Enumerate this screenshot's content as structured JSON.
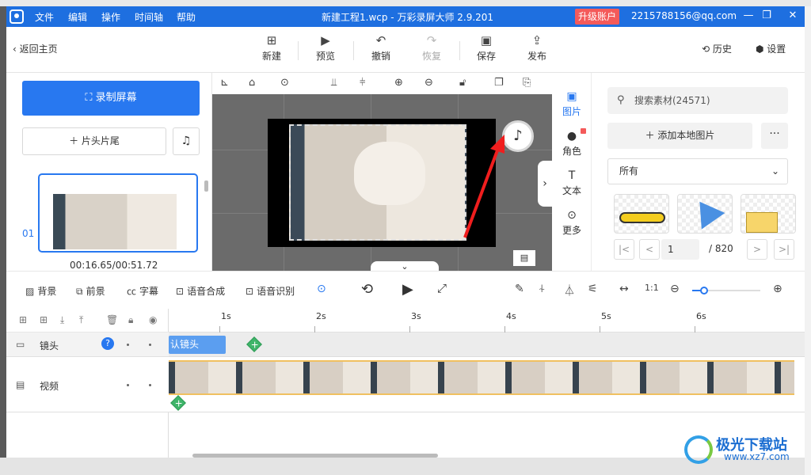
{
  "app": {
    "title": "新建工程1.wcp - 万彩录屏大师 2.9.201",
    "menu": [
      "文件",
      "编辑",
      "操作",
      "时间轴",
      "帮助"
    ],
    "upgrade_label": "升级账户",
    "account_email": "2215788156@qq.com",
    "window_controls": [
      "minimize-icon",
      "restore-icon",
      "maximize-icon",
      "close-icon"
    ]
  },
  "toolbar": {
    "back_label": "返回主页",
    "buttons": [
      {
        "label": "新建",
        "icon": "new-file-icon"
      },
      {
        "label": "预览",
        "icon": "play-icon"
      },
      {
        "label": "撤销",
        "icon": "undo-icon"
      },
      {
        "label": "恢复",
        "icon": "redo-icon",
        "disabled": true
      },
      {
        "label": "保存",
        "icon": "save-icon"
      },
      {
        "label": "发布",
        "icon": "publish-icon"
      }
    ],
    "history_label": "历史",
    "settings_label": "设置"
  },
  "left_panel": {
    "record_label": "录制屏幕",
    "head_tail_label": "片头片尾",
    "clip_index": "01",
    "clip_time": "00:16.65/00:51.72"
  },
  "side_tabs": [
    {
      "label": "图片",
      "icon": "image-icon",
      "active": true
    },
    {
      "label": "角色",
      "icon": "person-icon",
      "badge": "N"
    },
    {
      "label": "文本",
      "icon": "text-icon"
    },
    {
      "label": "更多",
      "icon": "more-icon"
    }
  ],
  "assets": {
    "search_placeholder": "搜索素材(24571)",
    "add_local_label": "添加本地图片",
    "more_label": "···",
    "filter_selected": "所有",
    "page_current": "1",
    "page_total": "/ 820"
  },
  "bottom_tools": {
    "background_label": "背景",
    "foreground_label": "前景",
    "subtitle_label": "字幕",
    "tts_label": "语音合成",
    "asr_label": "语音识别"
  },
  "timeline": {
    "ruler": [
      "1s",
      "2s",
      "3s",
      "4s",
      "5s",
      "6s"
    ],
    "tracks": [
      {
        "name": "镜头",
        "icon": "camera-icon"
      },
      {
        "name": "视频",
        "icon": "film-icon"
      }
    ],
    "lens_clip_label": "认镜头"
  },
  "watermark": {
    "name": "极光下载站",
    "url": "www.xz7.com"
  },
  "colors": {
    "accent": "#2878f0",
    "titlebar": "#1e6fe0",
    "upgrade": "#f45a5a"
  }
}
